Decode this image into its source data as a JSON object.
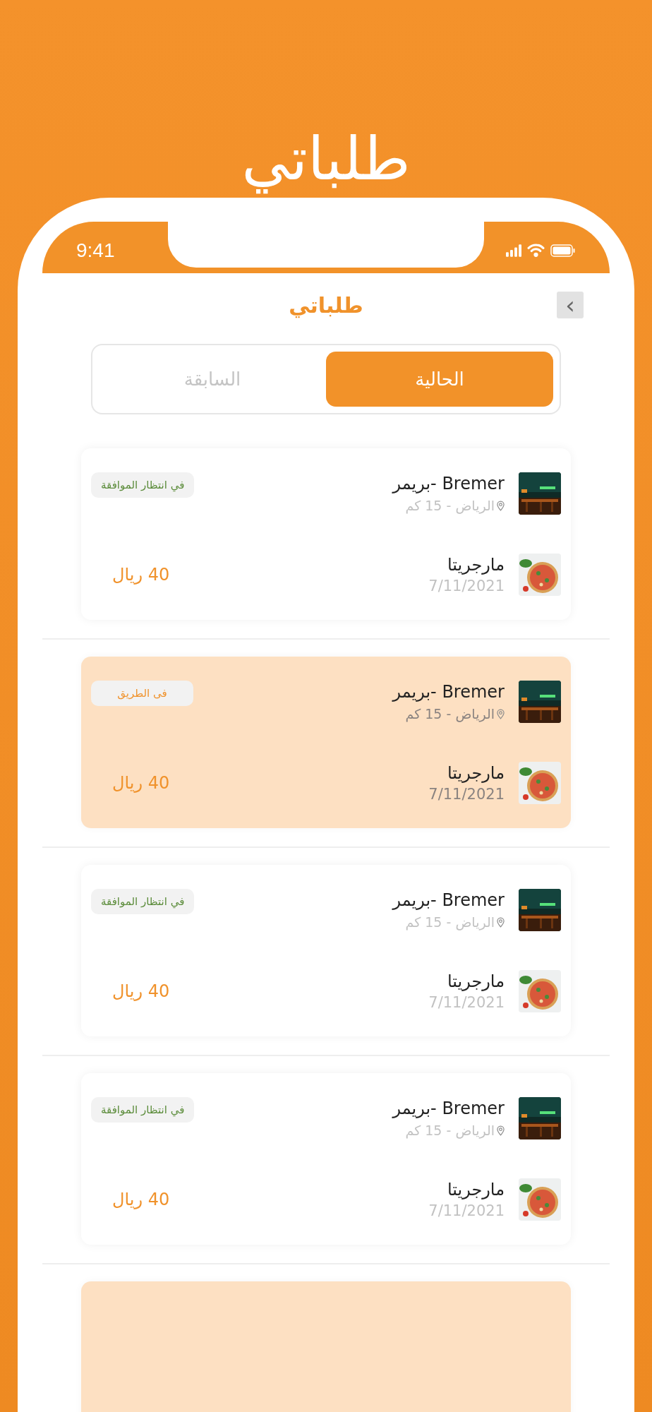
{
  "banner": {
    "title": "طلباتي"
  },
  "status_bar": {
    "time": "9:41"
  },
  "header": {
    "title": "طلباتي",
    "back": "›"
  },
  "tabs": [
    {
      "label": "الحالية",
      "selected": true
    },
    {
      "label": "السابقة",
      "selected": false
    }
  ],
  "orders": [
    {
      "highlighted": false,
      "restaurant": "Bremer -بريمر",
      "location": "الرياض - 15 كم",
      "item": "مارجريتا",
      "date": "7/11/2021",
      "price": "40 ريال",
      "status": {
        "label": "في انتظار الموافقة",
        "color": "#5b8c3a"
      }
    },
    {
      "highlighted": true,
      "restaurant": "Bremer -بريمر",
      "location": "الرياض - 15 كم",
      "item": "مارجريتا",
      "date": "7/11/2021",
      "price": "40 ريال",
      "status": {
        "label": "فى الطريق",
        "color": "#f0922b"
      }
    },
    {
      "highlighted": false,
      "restaurant": "Bremer -بريمر",
      "location": "الرياض - 15 كم",
      "item": "مارجريتا",
      "date": "7/11/2021",
      "price": "40 ريال",
      "status": {
        "label": "في انتظار الموافقة",
        "color": "#5b8c3a"
      }
    },
    {
      "highlighted": false,
      "restaurant": "Bremer -بريمر",
      "location": "الرياض - 15 كم",
      "item": "مارجريتا",
      "date": "7/11/2021",
      "price": "40 ريال",
      "status": {
        "label": "في انتظار الموافقة",
        "color": "#5b8c3a"
      }
    },
    {
      "highlighted": true
    }
  ]
}
